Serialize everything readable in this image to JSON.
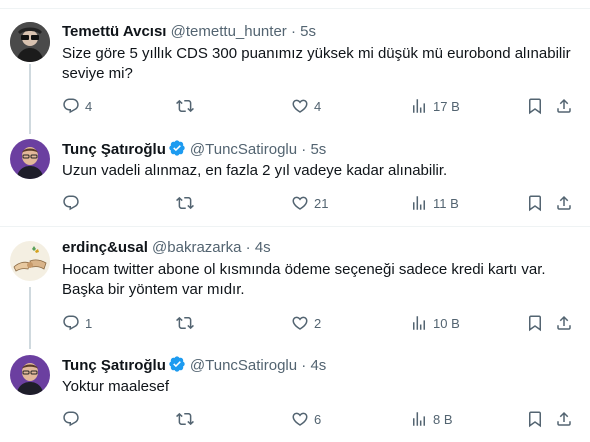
{
  "tweets": [
    {
      "name": "Temettü Avcısı",
      "handle": "@temettu_hunter",
      "separator": "·",
      "time": "5s",
      "verified": false,
      "text": "Size göre 5 yıllık CDS 300 puanımız yüksek mi düşük mü eurobond alınabilir seviye mi?",
      "replies": "4",
      "retweets": "",
      "likes": "4",
      "views": "17 B"
    },
    {
      "name": "Tunç Şatıroğlu",
      "handle": "@TuncSatiroglu",
      "separator": "·",
      "time": "5s",
      "verified": true,
      "text": "Uzun vadeli alınmaz, en fazla 2 yıl vadeye kadar alınabilir.",
      "replies": "",
      "retweets": "",
      "likes": "21",
      "views": "11 B"
    },
    {
      "name": "erdinç&usal",
      "handle": "@bakrazarka",
      "separator": "·",
      "time": "4s",
      "verified": false,
      "text": "Hocam twitter abone ol kısmında ödeme seçeneği sadece kredi kartı var. Başka bir yöntem var mıdır.",
      "replies": "1",
      "retweets": "",
      "likes": "2",
      "views": "10 B"
    },
    {
      "name": "Tunç Şatıroğlu",
      "handle": "@TuncSatiroglu",
      "separator": "·",
      "time": "4s",
      "verified": true,
      "text": "Yoktur maalesef",
      "replies": "",
      "retweets": "",
      "likes": "6",
      "views": "8 B"
    }
  ],
  "colors": {
    "text_primary": "#0f1419",
    "text_secondary": "#536471",
    "verified_blue": "#1d9bf0",
    "border": "#eff3f4",
    "thread_line": "#cfd9de"
  },
  "icons": [
    "reply-icon",
    "retweet-icon",
    "like-icon",
    "views-icon",
    "bookmark-icon",
    "share-icon",
    "verified-badge-icon"
  ]
}
